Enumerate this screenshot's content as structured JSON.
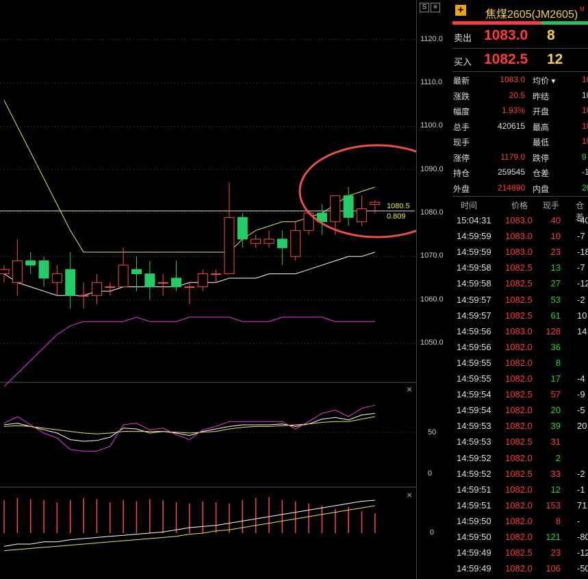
{
  "chart_data": {
    "type": "candlestick",
    "price_axis_ticks": [
      "1120.0",
      "1110.0",
      "1100.0",
      "1090.0",
      "1080.0",
      "1070.0",
      "1060.0",
      "1050.0"
    ],
    "candles": [
      {
        "o": 1066,
        "h": 1068,
        "l": 1064,
        "c": 1067
      },
      {
        "o": 1064,
        "h": 1074,
        "l": 1061,
        "c": 1069
      },
      {
        "o": 1069,
        "h": 1071,
        "l": 1066,
        "c": 1068
      },
      {
        "o": 1069,
        "h": 1070,
        "l": 1063,
        "c": 1065
      },
      {
        "o": 1064,
        "h": 1068,
        "l": 1061,
        "c": 1066
      },
      {
        "o": 1067,
        "h": 1071,
        "l": 1058,
        "c": 1061
      },
      {
        "o": 1061,
        "h": 1064,
        "l": 1058,
        "c": 1061
      },
      {
        "o": 1061,
        "h": 1066,
        "l": 1059,
        "c": 1064
      },
      {
        "o": 1063,
        "h": 1064,
        "l": 1061,
        "c": 1063
      },
      {
        "o": 1063,
        "h": 1072,
        "l": 1063,
        "c": 1068
      },
      {
        "o": 1067,
        "h": 1070,
        "l": 1062,
        "c": 1066
      },
      {
        "o": 1066,
        "h": 1069,
        "l": 1060,
        "c": 1063
      },
      {
        "o": 1064,
        "h": 1066,
        "l": 1061,
        "c": 1064
      },
      {
        "o": 1065,
        "h": 1069,
        "l": 1062,
        "c": 1063
      },
      {
        "o": 1063,
        "h": 1064,
        "l": 1059,
        "c": 1063
      },
      {
        "o": 1063,
        "h": 1067,
        "l": 1062,
        "c": 1066
      },
      {
        "o": 1066,
        "h": 1067,
        "l": 1064,
        "c": 1066
      },
      {
        "o": 1066,
        "h": 1087,
        "l": 1066,
        "c": 1079
      },
      {
        "o": 1079,
        "h": 1080,
        "l": 1072,
        "c": 1074
      },
      {
        "o": 1073,
        "h": 1075,
        "l": 1072,
        "c": 1074
      },
      {
        "o": 1073,
        "h": 1076,
        "l": 1072,
        "c": 1074
      },
      {
        "o": 1074,
        "h": 1076,
        "l": 1068,
        "c": 1072
      },
      {
        "o": 1070,
        "h": 1078,
        "l": 1069,
        "c": 1076
      },
      {
        "o": 1076,
        "h": 1080,
        "l": 1075,
        "c": 1080
      },
      {
        "o": 1080,
        "h": 1082,
        "l": 1075,
        "c": 1078
      },
      {
        "o": 1078,
        "h": 1084,
        "l": 1075,
        "c": 1084
      },
      {
        "o": 1084,
        "h": 1086,
        "l": 1077,
        "c": 1079
      },
      {
        "o": 1078,
        "h": 1084,
        "l": 1077,
        "c": 1081
      },
      {
        "o": 1082,
        "h": 1083,
        "l": 1080,
        "c": 1082.5
      }
    ],
    "ma_yellow": [
      1106,
      1100,
      1094,
      1088,
      1082,
      1076,
      1071,
      1071,
      1071,
      1071,
      1071,
      1071,
      1071,
      1071,
      1071,
      1071,
      1071,
      1071,
      1074,
      1076,
      1077,
      1078,
      1078,
      1079,
      1080,
      1082,
      1084,
      1085,
      1086
    ],
    "ma_white": [
      1066,
      1064,
      1063,
      1062,
      1061,
      1061,
      1061,
      1062,
      1062,
      1063,
      1063,
      1063,
      1063,
      1063,
      1064,
      1064,
      1064,
      1065,
      1065,
      1065,
      1066,
      1066,
      1066,
      1067,
      1068,
      1069,
      1070,
      1070,
      1071
    ],
    "ma_magenta": [
      1040,
      1043,
      1046,
      1049,
      1052,
      1054,
      1055,
      1055,
      1055,
      1055,
      1056,
      1055,
      1055,
      1055,
      1056,
      1056,
      1056,
      1056,
      1055,
      1055,
      1055,
      1056,
      1056,
      1056,
      1056,
      1055,
      1055,
      1055,
      1055
    ],
    "price_line": "1080.5",
    "price_line_sub": "0.809",
    "osc": {
      "ticks": [
        "50",
        "0"
      ],
      "k": [
        60,
        62,
        58,
        54,
        50,
        42,
        40,
        41,
        45,
        56,
        55,
        50,
        52,
        50,
        47,
        52,
        55,
        58,
        60,
        60,
        60,
        61,
        58,
        61,
        67,
        69,
        66,
        72,
        74
      ],
      "d": [
        58,
        59,
        58,
        56,
        54,
        52,
        50,
        49,
        50,
        52,
        52,
        52,
        52,
        51,
        50,
        51,
        52,
        55,
        57,
        58,
        58,
        59,
        60,
        61,
        63,
        64,
        64,
        67,
        70
      ],
      "j": [
        62,
        70,
        60,
        50,
        44,
        30,
        28,
        28,
        34,
        60,
        62,
        54,
        56,
        48,
        42,
        54,
        58,
        64,
        64,
        64,
        64,
        64,
        55,
        64,
        74,
        78,
        70,
        80,
        84
      ]
    },
    "macd": {
      "ticks": [
        "0"
      ],
      "hist": [
        30,
        32,
        31,
        30,
        28,
        30,
        32,
        31,
        28,
        30,
        29,
        31,
        30,
        28,
        27,
        29,
        28,
        27,
        30,
        32,
        33,
        30,
        29,
        27,
        25,
        22,
        24,
        20,
        18
      ],
      "dif": [
        -12,
        -10,
        -10,
        -8,
        -8,
        -6,
        -5,
        -4,
        -3,
        -2,
        -1,
        0,
        1,
        3,
        5,
        6,
        7,
        9,
        11,
        13,
        15,
        17,
        19,
        21,
        23,
        25,
        27,
        29,
        30
      ],
      "dea": [
        -16,
        -15,
        -14,
        -13,
        -12,
        -11,
        -10,
        -9,
        -8,
        -7,
        -6,
        -5,
        -4,
        -3,
        -1,
        0,
        2,
        3,
        5,
        7,
        9,
        11,
        13,
        15,
        17,
        19,
        21,
        23,
        25
      ]
    }
  },
  "toolbar": {
    "s1": "S",
    "s2": "≡"
  },
  "header": {
    "name": "焦煤2605(JM2605)",
    "mark": "M"
  },
  "sell": {
    "label": "卖出",
    "price": "1083.0",
    "vol": "8"
  },
  "buy": {
    "label": "买入",
    "price": "1082.5",
    "vol": "12"
  },
  "stats": [
    {
      "a": "最新",
      "b": "1083.0",
      "bc": "red",
      "c": "均价 ▾",
      "d": "10",
      "dc": "red"
    },
    {
      "a": "涨跌",
      "b": "20.5",
      "bc": "red",
      "c": "昨结",
      "d": "10",
      "dc": "white"
    },
    {
      "a": "幅度",
      "b": "1.93%",
      "bc": "red",
      "c": "开盘",
      "d": "10",
      "dc": "red"
    },
    {
      "a": "总手",
      "b": "420615",
      "bc": "white",
      "c": "最高",
      "d": "10",
      "dc": "red"
    },
    {
      "a": "现手",
      "b": "",
      "bc": "white",
      "c": "最低",
      "d": "10",
      "dc": "red"
    },
    {
      "a": "涨停",
      "b": "1179.0",
      "bc": "red",
      "c": "跌停",
      "d": "9",
      "dc": "green"
    },
    {
      "a": "持仓",
      "b": "259545",
      "bc": "white",
      "c": "仓差",
      "d": "-1",
      "dc": "white"
    },
    {
      "a": "外盘",
      "b": "214890",
      "bc": "red",
      "c": "内盘",
      "d": "20",
      "dc": "green"
    }
  ],
  "tick_header": {
    "time": "时间",
    "price": "价格",
    "vol": "现手",
    "oi": "仓差"
  },
  "ticks": [
    {
      "t": "15:04:31",
      "p": "1083.0",
      "pc": "red",
      "v": "40",
      "vc": "red",
      "o": "-40",
      "oc": "white"
    },
    {
      "t": "14:59:59",
      "p": "1083.0",
      "pc": "red",
      "v": "10",
      "vc": "red",
      "o": "-7",
      "oc": "white"
    },
    {
      "t": "14:59:59",
      "p": "1083.0",
      "pc": "red",
      "v": "23",
      "vc": "red",
      "o": "-18",
      "oc": "white"
    },
    {
      "t": "14:59:58",
      "p": "1082.5",
      "pc": "red",
      "v": "13",
      "vc": "green",
      "o": "-7",
      "oc": "white"
    },
    {
      "t": "14:59:58",
      "p": "1082.5",
      "pc": "red",
      "v": "27",
      "vc": "green",
      "o": "-12",
      "oc": "white"
    },
    {
      "t": "14:59:57",
      "p": "1082.5",
      "pc": "red",
      "v": "53",
      "vc": "green",
      "o": "-2",
      "oc": "white"
    },
    {
      "t": "14:59:57",
      "p": "1082.5",
      "pc": "red",
      "v": "61",
      "vc": "green",
      "o": "10",
      "oc": "white"
    },
    {
      "t": "14:59:56",
      "p": "1083.0",
      "pc": "red",
      "v": "128",
      "vc": "red",
      "o": "14",
      "oc": "white"
    },
    {
      "t": "14:59:56",
      "p": "1082.0",
      "pc": "red",
      "v": "36",
      "vc": "green",
      "o": "",
      "oc": "white"
    },
    {
      "t": "14:59:55",
      "p": "1082.0",
      "pc": "red",
      "v": "8",
      "vc": "green",
      "o": "",
      "oc": "white"
    },
    {
      "t": "14:59:55",
      "p": "1082.0",
      "pc": "red",
      "v": "17",
      "vc": "green",
      "o": "-4",
      "oc": "white"
    },
    {
      "t": "14:59:54",
      "p": "1082.5",
      "pc": "red",
      "v": "57",
      "vc": "red",
      "o": "-9",
      "oc": "white"
    },
    {
      "t": "14:59:54",
      "p": "1082.0",
      "pc": "red",
      "v": "20",
      "vc": "green",
      "o": "-5",
      "oc": "white"
    },
    {
      "t": "14:59:53",
      "p": "1082.0",
      "pc": "red",
      "v": "39",
      "vc": "green",
      "o": "20",
      "oc": "white"
    },
    {
      "t": "14:59:53",
      "p": "1082.5",
      "pc": "red",
      "v": "31",
      "vc": "red",
      "o": "",
      "oc": "white"
    },
    {
      "t": "14:59:52",
      "p": "1082.0",
      "pc": "red",
      "v": "2",
      "vc": "green",
      "o": "",
      "oc": "white"
    },
    {
      "t": "14:59:52",
      "p": "1082.5",
      "pc": "red",
      "v": "33",
      "vc": "red",
      "o": "-2",
      "oc": "white"
    },
    {
      "t": "14:59:51",
      "p": "1082.0",
      "pc": "red",
      "v": "12",
      "vc": "green",
      "o": "-1",
      "oc": "white"
    },
    {
      "t": "14:59:51",
      "p": "1082.0",
      "pc": "red",
      "v": "153",
      "vc": "red",
      "o": "71",
      "oc": "white"
    },
    {
      "t": "14:59:50",
      "p": "1082.0",
      "pc": "red",
      "v": "8",
      "vc": "red",
      "o": "-",
      "oc": "white"
    },
    {
      "t": "14:59:50",
      "p": "1082.0",
      "pc": "red",
      "v": "121",
      "vc": "green",
      "o": "-80",
      "oc": "white"
    },
    {
      "t": "14:59:49",
      "p": "1082.5",
      "pc": "red",
      "v": "23",
      "vc": "red",
      "o": "-12",
      "oc": "white"
    },
    {
      "t": "14:59:49",
      "p": "1082.0",
      "pc": "red",
      "v": "106",
      "vc": "red",
      "o": "-50",
      "oc": "white"
    }
  ],
  "colors": {
    "up": "#ff4a4a",
    "down": "#22cc66",
    "ma1": "#e8e850",
    "ma2": "#ffffff",
    "ma3": "#e040e0",
    "circle": "#e8504a"
  }
}
